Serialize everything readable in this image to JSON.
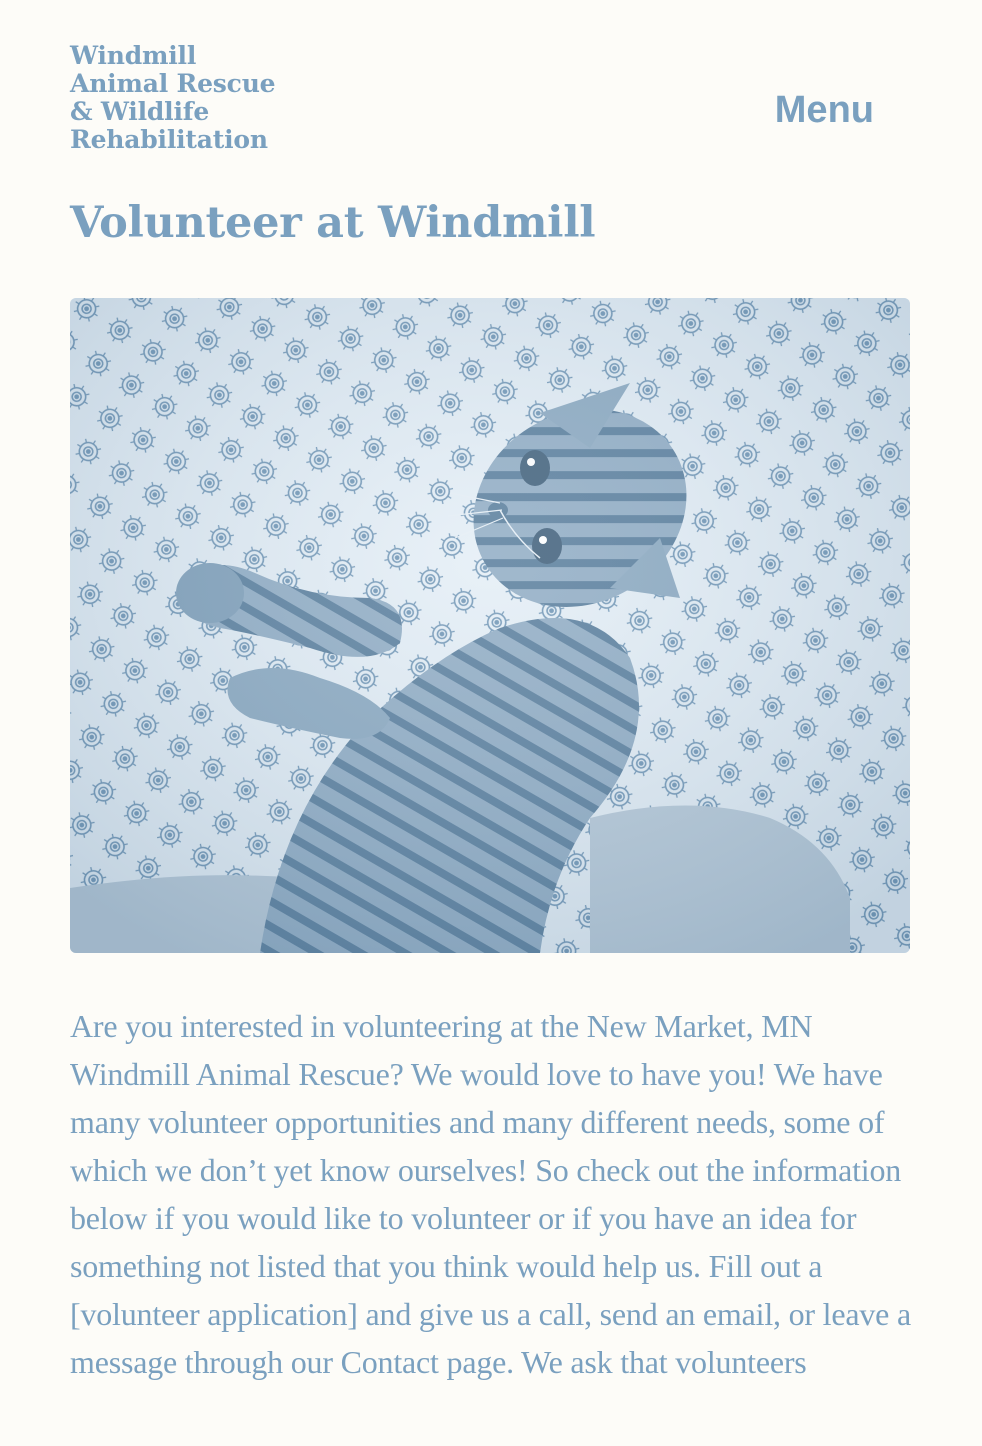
{
  "site": {
    "title_lines": [
      "Windmill",
      "Animal Rescue",
      "& Wildlife",
      "Rehabilitation"
    ],
    "menu_label": "Menu"
  },
  "page": {
    "title": "Volunteer at Windmill",
    "intro": "Are you interested in volunteering at the New Market, MN Windmill Animal Rescue? We would love to have you! We have many volunteer opportunities and many different needs, some of which we don’t yet know ourselves! So check out the information below if you would like to volunteer or if you have an idea for something not listed that you think would help us. Fill out a [volunteer application] and give us a call, send an email, or leave a message through our Contact page. We ask that volunteers"
  },
  "colors": {
    "text": "#7aa0bf",
    "background": "#fdfcf8",
    "image_tint": "#6f95b5"
  }
}
